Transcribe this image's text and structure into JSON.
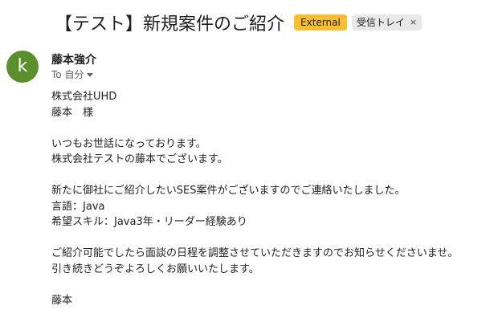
{
  "subject": "【テスト】新規案件のご紹介",
  "labels": {
    "external": "External",
    "inbox": "受信トレイ",
    "inbox_remove": "×"
  },
  "sender": {
    "avatar_letter": "k",
    "name": "藤本強介",
    "recipient": "To 自分"
  },
  "body_lines": {
    "l1": "株式会社UHD",
    "l2": "藤本　様",
    "l3": "いつもお世話になっております。",
    "l4": "株式会社テストの藤本でございます。",
    "l5": "新たに御社にご紹介したいSES案件がございますのでご連絡いたしました。",
    "l6": "言語：Java",
    "l7": "希望スキル：Java3年・リーダー経験あり",
    "l8": "ご紹介可能でしたら面談の日程を調整させていただきますのでお知らせくださいませ。",
    "l9": "引き続きどうぞよろしくお願いいたします。",
    "l10": "藤本"
  },
  "colors": {
    "avatar_bg": "#5b8f2c",
    "external_label_bg": "#f9bf2e",
    "inbox_label_bg": "#e8e8e8"
  }
}
